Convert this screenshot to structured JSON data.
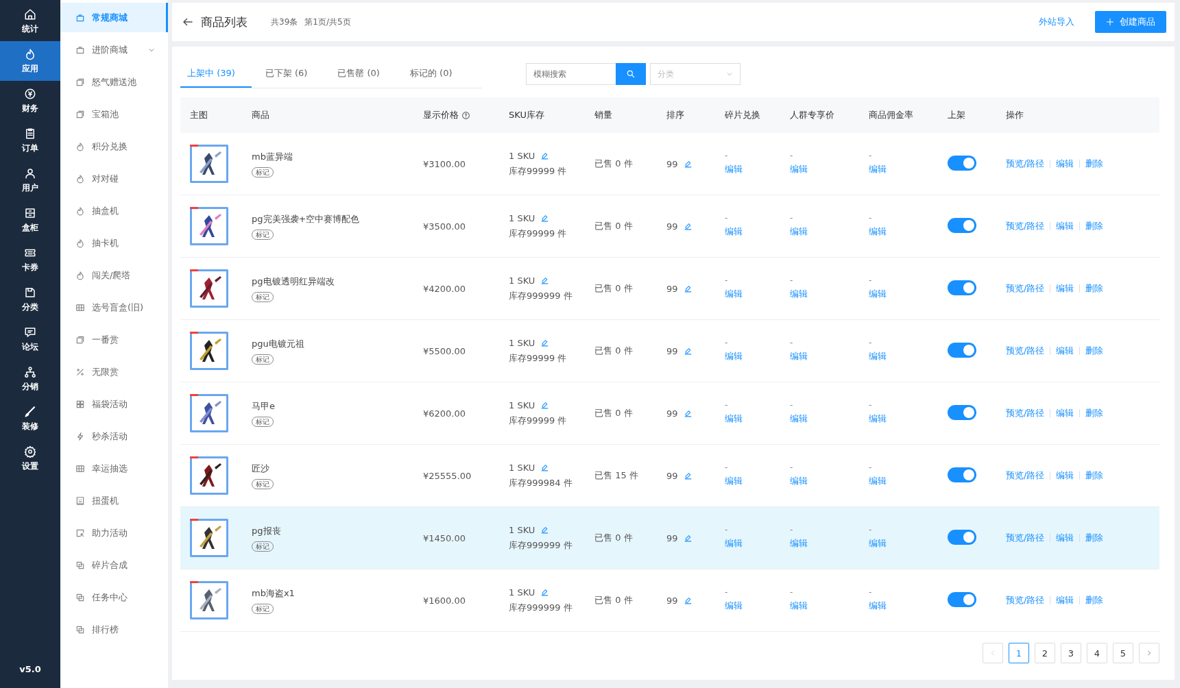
{
  "nav": {
    "items": [
      {
        "label": "统计",
        "selected": false
      },
      {
        "label": "应用",
        "selected": true
      },
      {
        "label": "财务",
        "selected": false
      },
      {
        "label": "订单",
        "selected": false
      },
      {
        "label": "用户",
        "selected": false
      },
      {
        "label": "盒柜",
        "selected": false
      },
      {
        "label": "卡券",
        "selected": false
      },
      {
        "label": "分类",
        "selected": false
      },
      {
        "label": "论坛",
        "selected": false
      },
      {
        "label": "分销",
        "selected": false
      },
      {
        "label": "装修",
        "selected": false
      },
      {
        "label": "设置",
        "selected": false
      }
    ],
    "version": "v5.0"
  },
  "submenu": {
    "items": [
      {
        "label": "常规商城",
        "selected": true,
        "expandable": false
      },
      {
        "label": "进阶商城",
        "selected": false,
        "expandable": true
      },
      {
        "label": "怒气赠送池",
        "selected": false,
        "expandable": false
      },
      {
        "label": "宝箱池",
        "selected": false,
        "expandable": false
      },
      {
        "label": "积分兑换",
        "selected": false,
        "expandable": false
      },
      {
        "label": "对对碰",
        "selected": false,
        "expandable": false
      },
      {
        "label": "抽盒机",
        "selected": false,
        "expandable": false
      },
      {
        "label": "抽卡机",
        "selected": false,
        "expandable": false
      },
      {
        "label": "闯关/爬塔",
        "selected": false,
        "expandable": false
      },
      {
        "label": "选号盲盒(旧)",
        "selected": false,
        "expandable": false
      },
      {
        "label": "一番赏",
        "selected": false,
        "expandable": false
      },
      {
        "label": "无限赏",
        "selected": false,
        "expandable": false
      },
      {
        "label": "福袋活动",
        "selected": false,
        "expandable": false
      },
      {
        "label": "秒杀活动",
        "selected": false,
        "expandable": false
      },
      {
        "label": "幸运抽选",
        "selected": false,
        "expandable": false
      },
      {
        "label": "扭蛋机",
        "selected": false,
        "expandable": false
      },
      {
        "label": "助力活动",
        "selected": false,
        "expandable": false
      },
      {
        "label": "碎片合成",
        "selected": false,
        "expandable": false
      },
      {
        "label": "任务中心",
        "selected": false,
        "expandable": false
      },
      {
        "label": "排行榜",
        "selected": false,
        "expandable": false
      }
    ]
  },
  "header": {
    "title": "商品列表",
    "total": "共39条",
    "page_info": "第1页/共5页",
    "import_link": "外站导入",
    "create_button": "创建商品"
  },
  "tabs": [
    {
      "label": "上架中 (39)",
      "selected": true
    },
    {
      "label": "已下架 (6)",
      "selected": false
    },
    {
      "label": "已售罄 (0)",
      "selected": false
    },
    {
      "label": "标记的 (0)",
      "selected": false
    }
  ],
  "search": {
    "placeholder": "模糊搜索"
  },
  "category_select": {
    "placeholder": "分类"
  },
  "table": {
    "columns": [
      "主图",
      "商品",
      "显示价格",
      "SKU库存",
      "销量",
      "排序",
      "碎片兑换",
      "人群专享价",
      "商品佣金率",
      "上架",
      "操作"
    ],
    "rows": [
      {
        "name": "mb蓝异端",
        "tag": "标记",
        "price": "¥3100.00",
        "sku": "1 SKU",
        "stock": "库存99999 件",
        "sales": "已售 0 件",
        "sort": "99",
        "fragment": "-",
        "fragment_link": "编辑",
        "crowd": "-",
        "crowd_link": "编辑",
        "commission": "-",
        "commission_link": "编辑",
        "on": true,
        "actions": [
          "预览/路径",
          "编辑",
          "删除"
        ],
        "selected": false
      },
      {
        "name": "pg完美强袭+空中赛博配色",
        "tag": "标记",
        "price": "¥3500.00",
        "sku": "1 SKU",
        "stock": "库存99999 件",
        "sales": "已售 0 件",
        "sort": "99",
        "fragment": "-",
        "fragment_link": "编辑",
        "crowd": "-",
        "crowd_link": "编辑",
        "commission": "-",
        "commission_link": "编辑",
        "on": true,
        "actions": [
          "预览/路径",
          "编辑",
          "删除"
        ],
        "selected": false
      },
      {
        "name": "pg电镀透明红异端改",
        "tag": "标记",
        "price": "¥4200.00",
        "sku": "1 SKU",
        "stock": "库存999999 件",
        "sales": "已售 0 件",
        "sort": "99",
        "fragment": "-",
        "fragment_link": "编辑",
        "crowd": "-",
        "crowd_link": "编辑",
        "commission": "-",
        "commission_link": "编辑",
        "on": true,
        "actions": [
          "预览/路径",
          "编辑",
          "删除"
        ],
        "selected": false
      },
      {
        "name": "pgu电镀元祖",
        "tag": "标记",
        "price": "¥5500.00",
        "sku": "1 SKU",
        "stock": "库存99999 件",
        "sales": "已售 0 件",
        "sort": "99",
        "fragment": "-",
        "fragment_link": "编辑",
        "crowd": "-",
        "crowd_link": "编辑",
        "commission": "-",
        "commission_link": "编辑",
        "on": true,
        "actions": [
          "预览/路径",
          "编辑",
          "删除"
        ],
        "selected": false
      },
      {
        "name": "马甲e",
        "tag": "标记",
        "price": "¥6200.00",
        "sku": "1 SKU",
        "stock": "库存99999 件",
        "sales": "已售 0 件",
        "sort": "99",
        "fragment": "-",
        "fragment_link": "编辑",
        "crowd": "-",
        "crowd_link": "编辑",
        "commission": "-",
        "commission_link": "编辑",
        "on": true,
        "actions": [
          "预览/路径",
          "编辑",
          "删除"
        ],
        "selected": false
      },
      {
        "name": "匠沙",
        "tag": "标记",
        "price": "¥25555.00",
        "sku": "1 SKU",
        "stock": "库存999984 件",
        "sales": "已售 15 件",
        "sort": "99",
        "fragment": "-",
        "fragment_link": "编辑",
        "crowd": "-",
        "crowd_link": "编辑",
        "commission": "-",
        "commission_link": "编辑",
        "on": true,
        "actions": [
          "预览/路径",
          "编辑",
          "删除"
        ],
        "selected": false
      },
      {
        "name": "pg报丧",
        "tag": "标记",
        "price": "¥1450.00",
        "sku": "1 SKU",
        "stock": "库存999999 件",
        "sales": "已售 0 件",
        "sort": "99",
        "fragment": "-",
        "fragment_link": "编辑",
        "crowd": "-",
        "crowd_link": "编辑",
        "commission": "-",
        "commission_link": "编辑",
        "on": true,
        "actions": [
          "预览/路径",
          "编辑",
          "删除"
        ],
        "selected": true
      },
      {
        "name": "mb海盗x1",
        "tag": "标记",
        "price": "¥1600.00",
        "sku": "1 SKU",
        "stock": "库存999999 件",
        "sales": "已售 0 件",
        "sort": "99",
        "fragment": "-",
        "fragment_link": "编辑",
        "crowd": "-",
        "crowd_link": "编辑",
        "commission": "-",
        "commission_link": "编辑",
        "on": true,
        "actions": [
          "预览/路径",
          "编辑",
          "删除"
        ],
        "selected": false
      }
    ]
  },
  "pagination": {
    "pages": [
      {
        "label": "1",
        "selected": true
      },
      {
        "label": "2",
        "selected": false
      },
      {
        "label": "3",
        "selected": false
      },
      {
        "label": "4",
        "selected": false
      },
      {
        "label": "5",
        "selected": false
      }
    ]
  }
}
